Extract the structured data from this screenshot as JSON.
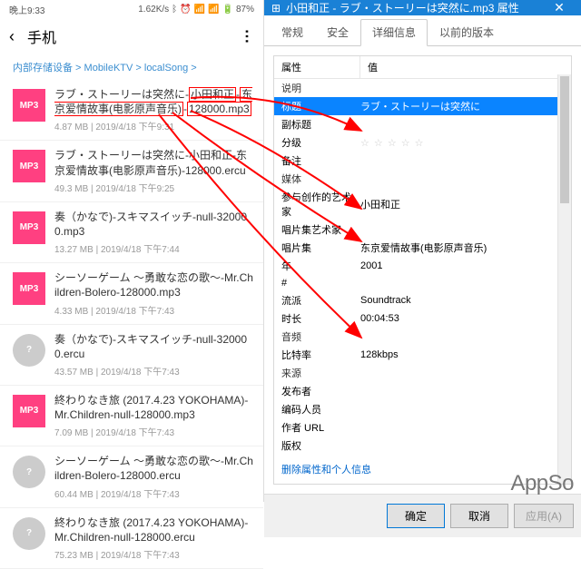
{
  "status": {
    "time": "晚上9:33",
    "speed": "1.62K/s",
    "battery": "87%"
  },
  "phone": {
    "title": "手机",
    "breadcrumb": "内部存储设备 > MobileKTV > localSong >",
    "files": [
      {
        "icon": "mp3",
        "name_parts": [
          "ラブ・ストーリーは突然に-",
          "小田和正",
          "-",
          "东京爱情故事(电影原声音乐)",
          "-",
          "128000.mp3"
        ],
        "boxed": true,
        "size": "4.87 MB",
        "date": "2019/4/18 下午9:31"
      },
      {
        "icon": "mp3",
        "name": "ラブ・ストーリーは突然に-小田和正-东京爱情故事(电影原声音乐)-128000.ercu",
        "size": "49.3 MB",
        "date": "2019/4/18 下午9:25"
      },
      {
        "icon": "mp3",
        "name": "奏（かなで)-スキマスイッチ-null-320000.mp3",
        "size": "13.27 MB",
        "date": "2019/4/18 下午7:44"
      },
      {
        "icon": "mp3",
        "name": "シーソーゲーム ～勇敢な恋の歌～-Mr.Children-Bolero-128000.mp3",
        "size": "4.33 MB",
        "date": "2019/4/18 下午7:43"
      },
      {
        "icon": "ercu",
        "name": "奏（かなで)-スキマスイッチ-null-320000.ercu",
        "size": "43.57 MB",
        "date": "2019/4/18 下午7:43"
      },
      {
        "icon": "mp3",
        "name": "終わりなき旅 (2017.4.23 YOKOHAMA)-Mr.Children-null-128000.mp3",
        "size": "7.09 MB",
        "date": "2019/4/18 下午7:43"
      },
      {
        "icon": "ercu",
        "name": "シーソーゲーム ～勇敢な恋の歌～-Mr.Children-Bolero-128000.ercu",
        "size": "60.44 MB",
        "date": "2019/4/18 下午7:43"
      },
      {
        "icon": "ercu",
        "name": "終わりなき旅 (2017.4.23 YOKOHAMA)-Mr.Children-null-128000.ercu",
        "size": "75.23 MB",
        "date": "2019/4/18 下午7:43"
      }
    ]
  },
  "win": {
    "title": "小田和正 - ラブ・ストーリーは突然に.mp3 属性",
    "tabs": [
      "常规",
      "安全",
      "详细信息",
      "以前的版本"
    ],
    "activeTab": 2,
    "hdr": {
      "c1": "属性",
      "c2": "值"
    },
    "rows": [
      {
        "k": "说明",
        "section": true
      },
      {
        "k": "标题",
        "v": "ラブ・ストーリーは突然に",
        "sel": true
      },
      {
        "k": "副标题"
      },
      {
        "k": "分级",
        "stars": true
      },
      {
        "k": "备注"
      },
      {
        "k": "媒体",
        "section": true
      },
      {
        "k": "参与创作的艺术家",
        "v": "小田和正"
      },
      {
        "k": "唱片集艺术家"
      },
      {
        "k": "唱片集",
        "v": "东京爱情故事(电影原声音乐)"
      },
      {
        "k": "年",
        "v": "2001"
      },
      {
        "k": "#"
      },
      {
        "k": "流派",
        "v": "Soundtrack"
      },
      {
        "k": "时长",
        "v": "00:04:53"
      },
      {
        "k": "音频",
        "section": true
      },
      {
        "k": "比特率",
        "v": "128kbps"
      },
      {
        "k": "来源",
        "section": true
      },
      {
        "k": "发布者"
      },
      {
        "k": "编码人员"
      },
      {
        "k": "作者 URL"
      },
      {
        "k": "版权"
      }
    ],
    "link": "删除属性和个人信息",
    "buttons": {
      "ok": "确定",
      "cancel": "取消",
      "apply": "应用(A)"
    }
  },
  "logo": "AppSo"
}
